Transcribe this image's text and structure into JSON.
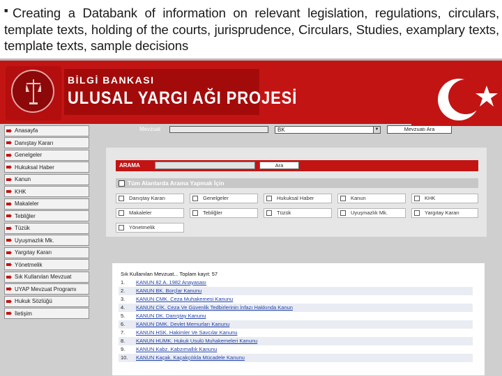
{
  "caption": {
    "text": "Creating a Databank of information on relevant legislation, regulations, circulars, template texts, holding of the courts, jurisprudence, Circulars, Studies, examplary texts, template texts, sample decisions"
  },
  "header": {
    "subtitle": "BİLGİ BANKASI",
    "title": "ULUSAL YARGI AĞI PROJESİ"
  },
  "sidebar": {
    "items": [
      {
        "label": "Anasayfa"
      },
      {
        "label": "Danıştay Kararı"
      },
      {
        "label": "Genelgeler"
      },
      {
        "label": "Hukuksal Haber"
      },
      {
        "label": "Kanun"
      },
      {
        "label": "KHK"
      },
      {
        "label": "Makaleler"
      },
      {
        "label": "Tebliğler"
      },
      {
        "label": "Tüzük"
      },
      {
        "label": "Uyuşmazlık Mk."
      },
      {
        "label": "Yargıtay Kararı"
      },
      {
        "label": "Yönetmelik"
      },
      {
        "label": "Sık Kullanılan Mevzuat"
      },
      {
        "label": "UYAP Mevzuat Programı"
      },
      {
        "label": "Hukuk Sözlüğü"
      },
      {
        "label": "İletişim"
      }
    ]
  },
  "top_search": {
    "label": "Mevzuat",
    "select_value": "BK",
    "button": "Mevzuatı Ara"
  },
  "search": {
    "bar_label": "ARAMA",
    "button": "Ara",
    "all_fields_label": "Tüm Alanlarda Arama Yapmak İçin"
  },
  "categories": {
    "row1": [
      "Danıştay Kararı",
      "Genelgeler",
      "Hukuksal Haber",
      "Kanun",
      "KHK"
    ],
    "row2": [
      "Makaleler",
      "Tebliğler",
      "Tüzük",
      "Uyuşmazlık Mk.",
      "Yargıtay Kararı"
    ],
    "row3": [
      "Yönetmelik"
    ]
  },
  "results": {
    "title": "Sık Kullanılan Mevzuat... Toplam kayıt: 57",
    "rows": [
      {
        "num": "1.",
        "text": "KANUN 82 A. 1982 Anayasası"
      },
      {
        "num": "2.",
        "text": "KANUN BK. Borçlar Kanunu"
      },
      {
        "num": "3.",
        "text": "KANUN CMK. Ceza Muhakemesi Kanunu"
      },
      {
        "num": "4.",
        "text": "KANUN CİK. Ceza Ve Güvenlik Tedbirlerinin İnfazı Hakkında Kanun"
      },
      {
        "num": "5.",
        "text": "KANUN DK. Danıştay Kanunu"
      },
      {
        "num": "6.",
        "text": "KANUN DMK. Devlet Memurları Kanunu"
      },
      {
        "num": "7.",
        "text": "KANUN HSK. Hakimler Ve Savcılar Kanunu"
      },
      {
        "num": "8.",
        "text": "KANUN HUMK. Hukuk Usulü Muhakemeleri Kanunu"
      },
      {
        "num": "9.",
        "text": "KANUN Kabz. Kabzımallık Kanunu"
      },
      {
        "num": "10.",
        "text": "KANUN Kaçak. Kaçakçılıkla Mücadele Kanunu"
      }
    ]
  },
  "colors": {
    "brand_red": "#c31414",
    "link_blue": "#1f3fa8"
  }
}
